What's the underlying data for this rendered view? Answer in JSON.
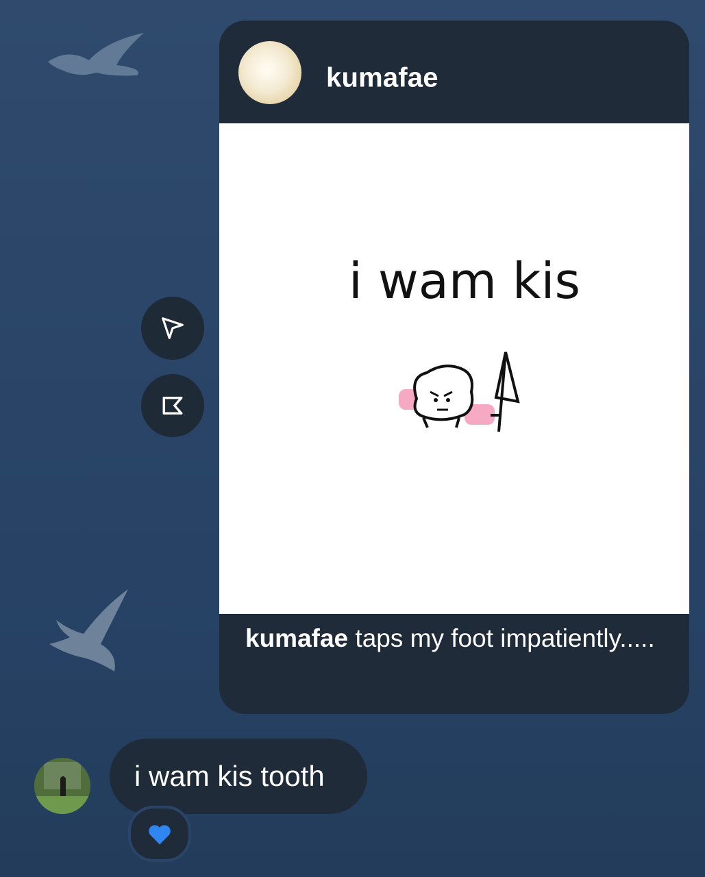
{
  "post": {
    "username": "kumafae",
    "image_text": "i wam kis",
    "caption_user": "kumafae",
    "caption_text": " taps my foot impatiently....."
  },
  "message": {
    "text": "i wam kis tooth",
    "reaction": "blue-heart"
  },
  "icons": {
    "share": "paper-plane-icon",
    "save": "bookmark-icon"
  },
  "colors": {
    "background": "#2a4568",
    "card": "#1f2b39",
    "heart": "#2f86f1"
  }
}
